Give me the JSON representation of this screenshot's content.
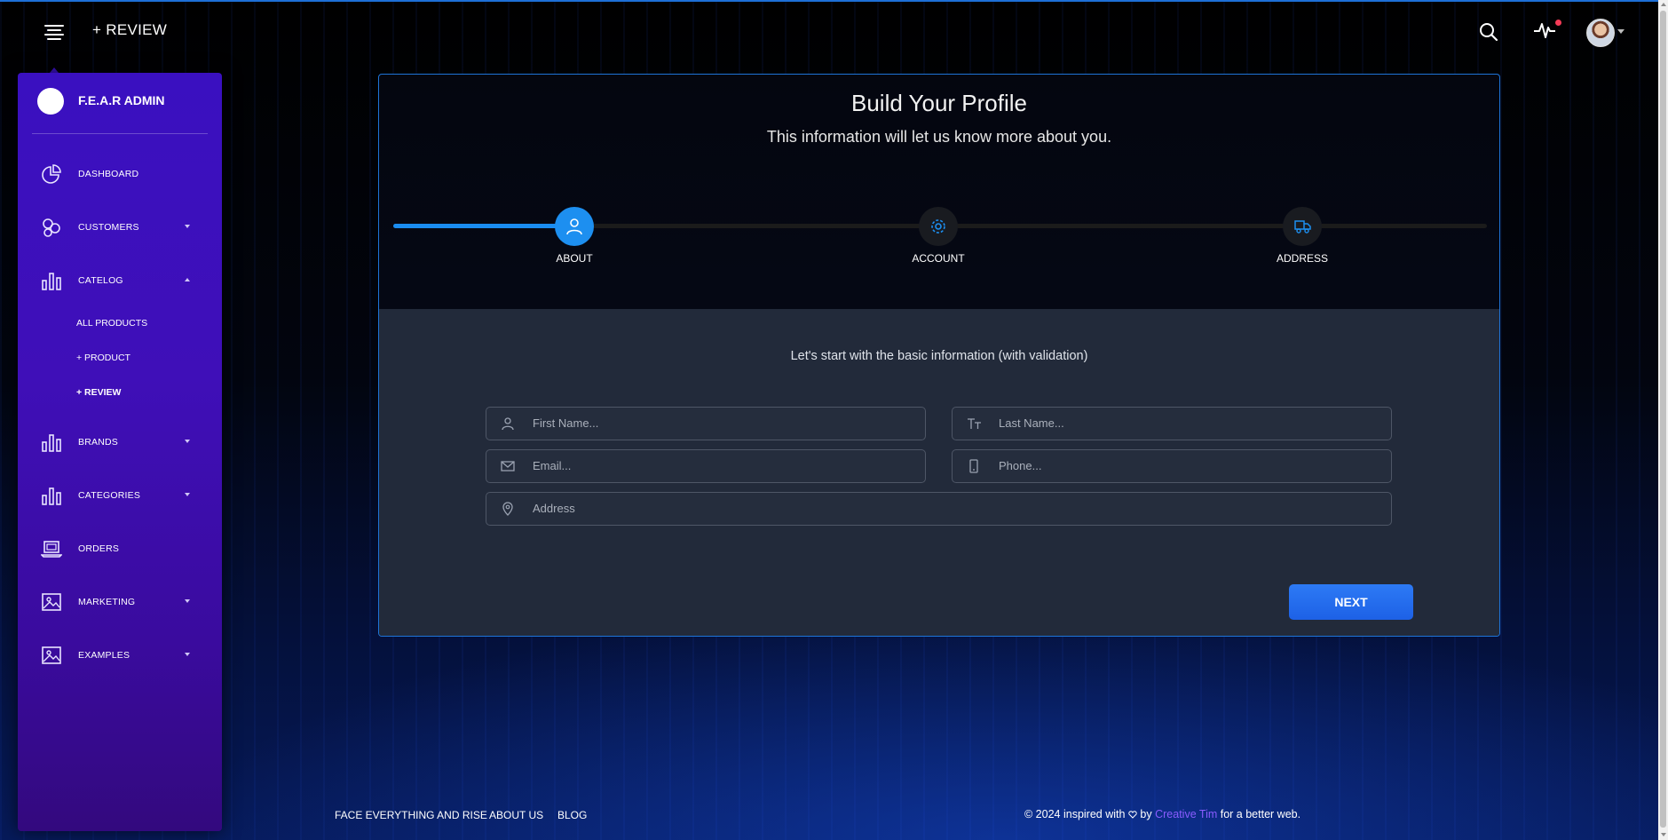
{
  "navbar": {
    "title": "+ REVIEW",
    "icons": [
      "hamburger-menu-icon",
      "search-icon",
      "activity-pulse-icon",
      "user-avatar"
    ]
  },
  "sidebar": {
    "brand": "F.E.A.R ADMIN",
    "items": [
      {
        "label": "DASHBOARD",
        "icon": "pie-chart-icon",
        "caret": ""
      },
      {
        "label": "CUSTOMERS",
        "icon": "atom-icon",
        "caret": "down"
      },
      {
        "label": "CATELOG",
        "icon": "bar-chart-icon",
        "caret": "up"
      },
      {
        "label": "BRANDS",
        "icon": "bar-chart-icon",
        "caret": "down"
      },
      {
        "label": "CATEGORIES",
        "icon": "bar-chart-icon",
        "caret": "down"
      },
      {
        "label": "ORDERS",
        "icon": "laptop-icon",
        "caret": ""
      },
      {
        "label": "MARKETING",
        "icon": "image-icon",
        "caret": "down"
      },
      {
        "label": "EXAMPLES",
        "icon": "image-icon",
        "caret": "down"
      }
    ],
    "subitems": [
      {
        "label": "ALL PRODUCTS",
        "active": false
      },
      {
        "label": "+ PRODUCT",
        "active": false
      },
      {
        "label": "+ REVIEW",
        "active": true
      }
    ]
  },
  "wizard": {
    "title": "Build Your Profile",
    "subtitle": "This information will let us know more about you.",
    "steps": [
      {
        "label": "ABOUT",
        "icon": "user-icon",
        "active": true
      },
      {
        "label": "ACCOUNT",
        "icon": "gear-icon",
        "active": false
      },
      {
        "label": "ADDRESS",
        "icon": "delivery-truck-icon",
        "active": false
      }
    ],
    "heading": "Let's start with the basic information (with validation)",
    "fields": {
      "first_name": {
        "placeholder": "First Name...",
        "value": ""
      },
      "last_name": {
        "placeholder": "Last Name...",
        "value": ""
      },
      "email": {
        "placeholder": "Email...",
        "value": ""
      },
      "phone": {
        "placeholder": "Phone...",
        "value": ""
      },
      "address": {
        "placeholder": "Address",
        "value": ""
      }
    },
    "next_label": "NEXT"
  },
  "footer": {
    "links": [
      "FACE EVERYTHING AND RISE",
      "ABOUT US",
      "BLOG"
    ],
    "copy_prefix": "© 2024 inspired with",
    "copy_by": "by",
    "brand": "Creative Tim",
    "copy_suffix": "for a better web."
  },
  "colors": {
    "accent": "#1d8ff0",
    "sidebar_top": "#3a10c0",
    "sidebar_bottom": "#33097e",
    "card_border": "#1e74d8",
    "panel_bg": "#222a3a",
    "notification_dot": "#f53b57",
    "brand_link": "#8a5cff"
  }
}
